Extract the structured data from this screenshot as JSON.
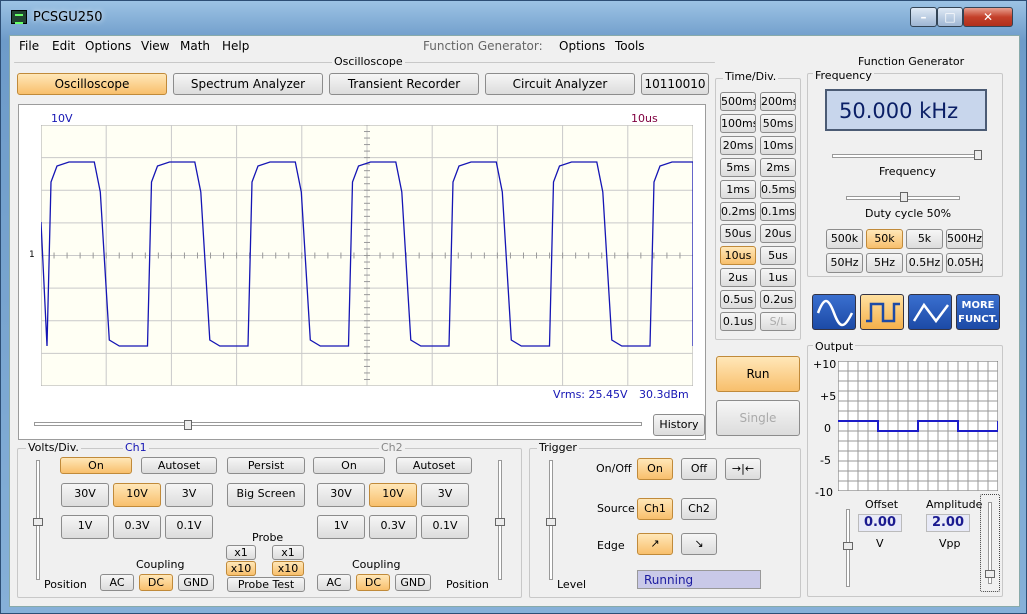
{
  "app": {
    "title": "PCSGU250"
  },
  "menu": {
    "file": "File",
    "edit": "Edit",
    "options": "Options",
    "view": "View",
    "math": "Math",
    "help": "Help",
    "fg": "Function Generator:",
    "fg_options": "Options",
    "fg_tools": "Tools"
  },
  "oscilloscope": {
    "group_label": "Oscilloscope",
    "tabs": {
      "oscilloscope": "Oscilloscope",
      "spectrum": "Spectrum Analyzer",
      "transient": "Transient Recorder",
      "circuit": "Circuit Analyzer",
      "code": "10110010"
    },
    "ch1_scale": "10V",
    "time_scale": "10us",
    "marker": "1",
    "vrms": "Vrms: 25.45V",
    "dbm": "30.3dBm",
    "history": "History"
  },
  "timediv": {
    "label": "Time/Div.",
    "buttons": [
      "500ms",
      "200ms",
      "100ms",
      "50ms",
      "20ms",
      "10ms",
      "5ms",
      "2ms",
      "1ms",
      "0.5ms",
      "0.2ms",
      "0.1ms",
      "50us",
      "20us",
      "10us",
      "5us",
      "2us",
      "1us",
      "0.5us",
      "0.2us",
      "0.1us",
      "S/L"
    ],
    "selected": "10us",
    "run": "Run",
    "single": "Single"
  },
  "volts": {
    "label": "Volts/Div.",
    "ch1": "Ch1",
    "ch2": "Ch2",
    "on": "On",
    "autoset": "Autoset",
    "persist": "Persist",
    "big_screen": "Big Screen",
    "r1": [
      "30V",
      "10V",
      "3V"
    ],
    "r2": [
      "1V",
      "0.3V",
      "0.1V"
    ],
    "selected": "10V",
    "probe": "Probe",
    "x1": "x1",
    "x10": "x10",
    "probe_test": "Probe Test",
    "coupling": "Coupling",
    "ac": "AC",
    "dc": "DC",
    "gnd": "GND",
    "position": "Position"
  },
  "trigger": {
    "label": "Trigger",
    "onoff": "On/Off",
    "on": "On",
    "off": "Off",
    "source": "Source",
    "ch1": "Ch1",
    "ch2": "Ch2",
    "edge": "Edge",
    "level": "Level",
    "status": "Running"
  },
  "fg": {
    "group_label": "Function Generator",
    "freq_label": "Frequency",
    "freq_value": "50.000 kHz",
    "freq_slider": "Frequency",
    "duty": "Duty cycle 50%",
    "ranges": [
      "500k",
      "50k",
      "5k",
      "500Hz",
      "50Hz",
      "5Hz",
      "0.5Hz",
      "0.05Hz"
    ],
    "selected_range": "50k",
    "more": "MORE FUNCT.",
    "output": "Output",
    "yticks": [
      "+10",
      "+5",
      "0",
      "-5",
      "-10"
    ],
    "offset_label": "Offset",
    "offset_value": "0.00",
    "offset_unit": "V",
    "amp_label": "Amplitude",
    "amp_value": "2.00",
    "amp_unit": "Vpp"
  },
  "colors": {
    "trace": "#1515b4",
    "accent": "#f8bf6c",
    "lcd": "#c8d6ec"
  }
}
